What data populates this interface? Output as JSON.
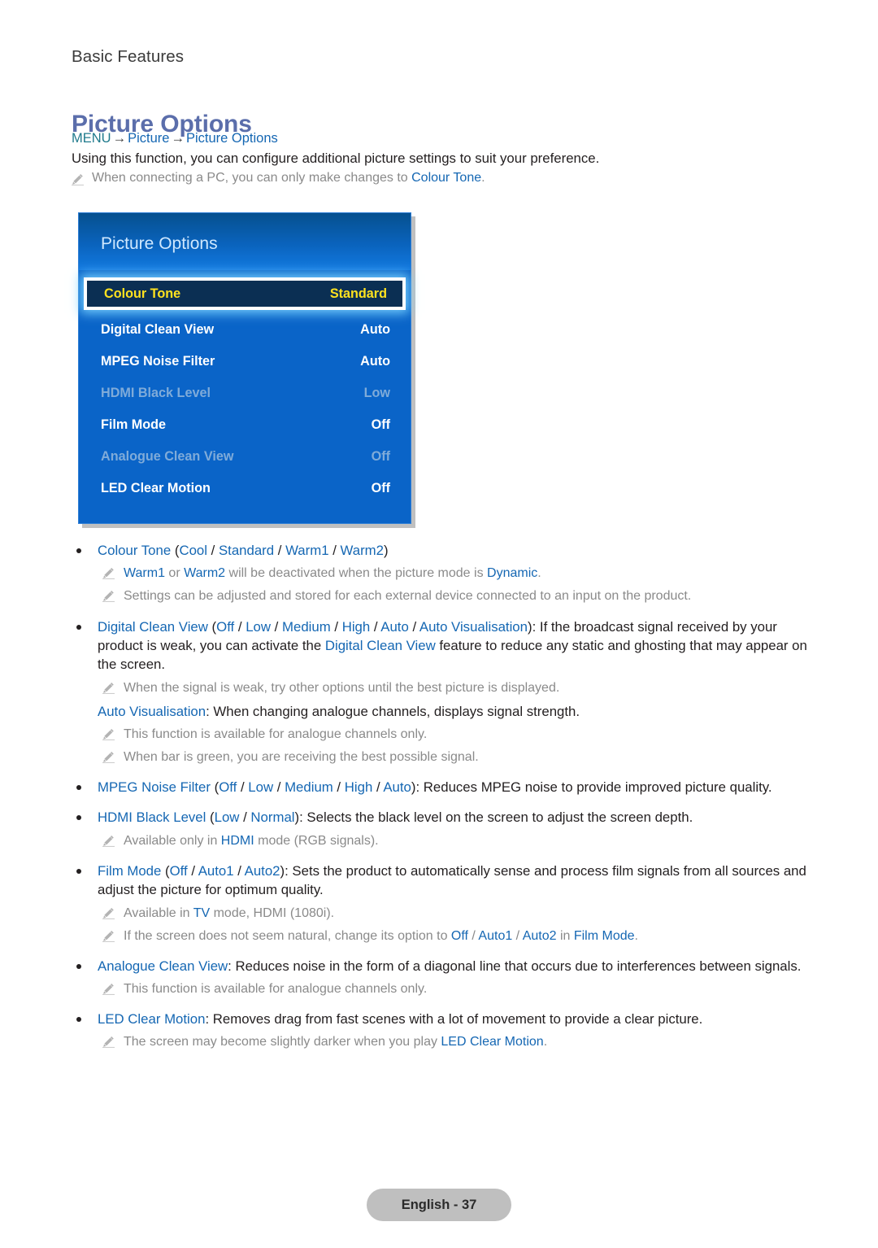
{
  "running_header": "Basic Features",
  "section_title": "Picture Options",
  "breadcrumb": {
    "menu": "MENU",
    "arrow": "→",
    "level1": "Picture",
    "level2": "Picture Options"
  },
  "intro": "Using this function, you can configure additional picture settings to suit your preference.",
  "intro_note": {
    "icon": "pencil-icon",
    "text_before": "When connecting a PC, you can only make changes to ",
    "link": "Colour Tone",
    "text_after": "."
  },
  "osd": {
    "title": "Picture Options",
    "rows": [
      {
        "label": "Colour Tone",
        "value": "Standard",
        "state": "selected"
      },
      {
        "label": "Digital Clean View",
        "value": "Auto",
        "state": "enabled"
      },
      {
        "label": "MPEG Noise Filter",
        "value": "Auto",
        "state": "enabled"
      },
      {
        "label": "HDMI Black Level",
        "value": "Low",
        "state": "disabled"
      },
      {
        "label": "Film Mode",
        "value": "Off",
        "state": "enabled"
      },
      {
        "label": "Analogue Clean View",
        "value": "Off",
        "state": "disabled"
      },
      {
        "label": "LED Clear Motion",
        "value": "Off",
        "state": "enabled"
      }
    ]
  },
  "body": {
    "b1": {
      "term": "Colour Tone",
      "paren_open": " (",
      "opt1": "Cool",
      "sep1": " / ",
      "opt2": "Standard",
      "sep2": " / ",
      "opt3": "Warm1",
      "sep3": " / ",
      "opt4": "Warm2",
      "paren_close": ")"
    },
    "b1n1": {
      "t1": "Warm1",
      "t2": " or ",
      "t3": "Warm2",
      "t4": " will be deactivated when the picture mode is ",
      "t5": "Dynamic",
      "t6": "."
    },
    "b1n2": "Settings can be adjusted and stored for each external device connected to an input on the product.",
    "b2": {
      "term": "Digital Clean View",
      "paren_open": " (",
      "opt1": "Off",
      "sep1": " / ",
      "opt2": "Low",
      "sep2": " / ",
      "opt3": "Medium",
      "sep3": " / ",
      "opt4": "High",
      "sep4": " / ",
      "opt5": "Auto",
      "sep5": " / ",
      "opt6": "Auto Visualisation",
      "paren_close": ")",
      "rest1": ": If the broadcast signal received by your product is weak, you can activate the ",
      "link": "Digital Clean View",
      "rest2": " feature to reduce any static and ghosting that may appear on the screen."
    },
    "b2n1": "When the signal is weak, try other options until the best picture is displayed.",
    "b2p": {
      "term": "Auto Visualisation",
      "rest": ": When changing analogue channels, displays signal strength."
    },
    "b2n2": "This function is available for analogue channels only.",
    "b2n3": "When bar is green, you are receiving the best possible signal.",
    "b3": {
      "term": "MPEG Noise Filter",
      "paren_open": " (",
      "opt1": "Off",
      "sep1": " / ",
      "opt2": "Low",
      "sep2": " / ",
      "opt3": "Medium",
      "sep3": " / ",
      "opt4": "High",
      "sep4": " / ",
      "opt5": "Auto",
      "paren_close": ")",
      "rest": ": Reduces MPEG noise to provide improved picture quality."
    },
    "b4": {
      "term": "HDMI Black Level",
      "paren_open": " (",
      "opt1": "Low",
      "sep1": " / ",
      "opt2": "Normal",
      "paren_close": ")",
      "rest": ": Selects the black level on the screen to adjust the screen depth."
    },
    "b4n1": {
      "t1": "Available only in ",
      "t2": "HDMI",
      "t3": " mode (RGB signals)."
    },
    "b5": {
      "term": "Film Mode",
      "paren_open": " (",
      "opt1": "Off",
      "sep1": " / ",
      "opt2": "Auto1",
      "sep2": " / ",
      "opt3": "Auto2",
      "paren_close": ")",
      "rest": ": Sets the product to automatically sense and process film signals from all sources and adjust the picture for optimum quality."
    },
    "b5n1": {
      "t1": "Available in ",
      "t2": "TV",
      "t3": " mode, HDMI (1080i)."
    },
    "b5n2": {
      "t1": "If the screen does not seem natural, change its option to ",
      "t2": "Off",
      "t3": " / ",
      "t4": "Auto1",
      "t5": " / ",
      "t6": "Auto2",
      "t7": " in ",
      "t8": "Film Mode",
      "t9": "."
    },
    "b6": {
      "term": "Analogue Clean View",
      "rest": ": Reduces noise in the form of a diagonal line that occurs due to interferences between signals."
    },
    "b6n1": "This function is available for analogue channels only.",
    "b7": {
      "term": "LED Clear Motion",
      "rest": ": Removes drag from fast scenes with a lot of movement to provide a clear picture."
    },
    "b7n1": {
      "t1": "The screen may become slightly darker when you play ",
      "t2": "LED Clear Motion",
      "t3": "."
    }
  },
  "footer": {
    "label": "English - 37"
  }
}
